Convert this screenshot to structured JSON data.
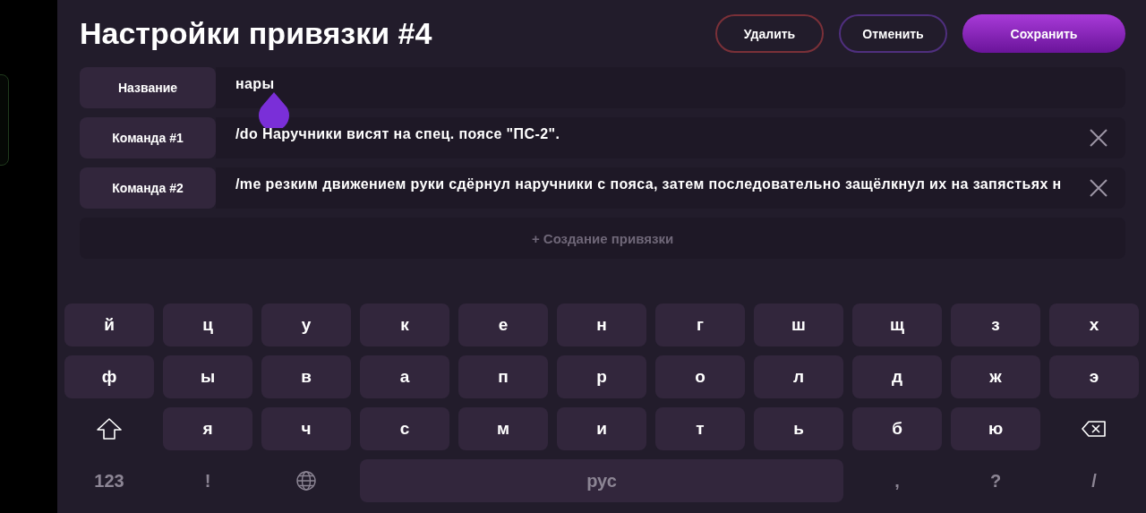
{
  "title": "Настройки привязки #4",
  "buttons": [
    {
      "label": "Удалить",
      "kind": "danger"
    },
    {
      "label": "Отменить",
      "kind": "outline"
    },
    {
      "label": "Сохранить",
      "kind": "primary"
    }
  ],
  "fields": [
    {
      "label": "Название",
      "value": "нары",
      "clearable": false,
      "focused": true
    },
    {
      "label": "Команда #1",
      "value": "/do Наручники висят на спец. поясе \"ПС-2\".",
      "clearable": true,
      "focused": false
    },
    {
      "label": "Команда #2",
      "value": "/me резким движением руки сдёрнул наручники с пояса, затем последовательно защёлкнул их на запястьях н",
      "clearable": true,
      "focused": false
    }
  ],
  "add_button": {
    "label": "+ Создание привязки"
  },
  "keyboard": [
    [
      {
        "kind": "letter",
        "label": "й"
      },
      {
        "kind": "letter",
        "label": "ц"
      },
      {
        "kind": "letter",
        "label": "у"
      },
      {
        "kind": "letter",
        "label": "к"
      },
      {
        "kind": "letter",
        "label": "е"
      },
      {
        "kind": "letter",
        "label": "н"
      },
      {
        "kind": "letter",
        "label": "г"
      },
      {
        "kind": "letter",
        "label": "ш"
      },
      {
        "kind": "letter",
        "label": "щ"
      },
      {
        "kind": "letter",
        "label": "з"
      },
      {
        "kind": "letter",
        "label": "х"
      }
    ],
    [
      {
        "kind": "letter",
        "label": "ф"
      },
      {
        "kind": "letter",
        "label": "ы"
      },
      {
        "kind": "letter",
        "label": "в"
      },
      {
        "kind": "letter",
        "label": "а"
      },
      {
        "kind": "letter",
        "label": "п"
      },
      {
        "kind": "letter",
        "label": "р"
      },
      {
        "kind": "letter",
        "label": "о"
      },
      {
        "kind": "letter",
        "label": "л"
      },
      {
        "kind": "letter",
        "label": "д"
      },
      {
        "kind": "letter",
        "label": "ж"
      },
      {
        "kind": "letter",
        "label": "э"
      }
    ],
    [
      {
        "kind": "shift"
      },
      {
        "kind": "letter",
        "label": "я"
      },
      {
        "kind": "letter",
        "label": "ч"
      },
      {
        "kind": "letter",
        "label": "с"
      },
      {
        "kind": "letter",
        "label": "м"
      },
      {
        "kind": "letter",
        "label": "и"
      },
      {
        "kind": "letter",
        "label": "т"
      },
      {
        "kind": "letter",
        "label": "ь"
      },
      {
        "kind": "letter",
        "label": "б"
      },
      {
        "kind": "letter",
        "label": "ю"
      },
      {
        "kind": "backspace"
      }
    ],
    [
      {
        "kind": "symbol",
        "label": "123"
      },
      {
        "kind": "symbol",
        "label": "!"
      },
      {
        "kind": "globe"
      },
      {
        "kind": "space",
        "label": "рус"
      },
      {
        "kind": "symbol",
        "label": ","
      },
      {
        "kind": "symbol",
        "label": "?"
      },
      {
        "kind": "symbol",
        "label": "/"
      }
    ]
  ]
}
